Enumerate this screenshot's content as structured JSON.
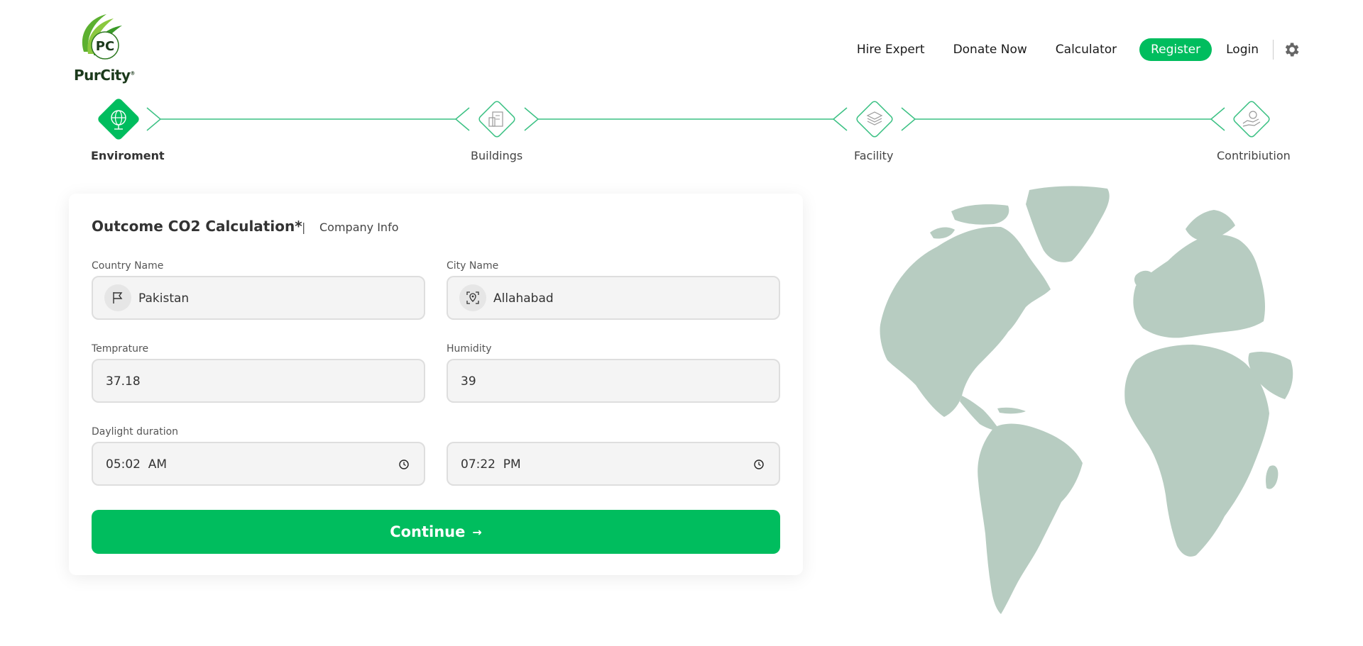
{
  "brand": {
    "logo_initials": "PC",
    "logo_name": "PurCity",
    "logo_mark": "®"
  },
  "nav": {
    "hire_expert": "Hire Expert",
    "donate_now": "Donate Now",
    "calculator": "Calculator",
    "register": "Register",
    "login": "Login"
  },
  "stepper": {
    "steps": [
      {
        "label": "Enviroment",
        "icon": "globe-icon",
        "active": true
      },
      {
        "label": "Buildings",
        "icon": "building-icon",
        "active": false
      },
      {
        "label": "Facility",
        "icon": "layers-icon",
        "active": false
      },
      {
        "label": "Contribiution",
        "icon": "hand-heart-icon",
        "active": false
      }
    ]
  },
  "form": {
    "title": "Outcome CO2 Calculation*",
    "separator": "|",
    "subtitle": "Company Info",
    "country": {
      "label": "Country Name",
      "value": "Pakistan",
      "icon": "flag-icon"
    },
    "city": {
      "label": "City Name",
      "value": "Allahabad",
      "icon": "location-pin-icon"
    },
    "temperature": {
      "label": "Temprature",
      "value": "37.18"
    },
    "humidity": {
      "label": "Humidity",
      "value": "39"
    },
    "daylight": {
      "label": "Daylight duration",
      "start": "05:02  AM",
      "end": "07:22  PM"
    },
    "continue_label": "Continue",
    "continue_arrow": "→"
  },
  "colors": {
    "accent": "#00bd5e",
    "globe": "#b7ccc1",
    "line": "#3cc184"
  }
}
